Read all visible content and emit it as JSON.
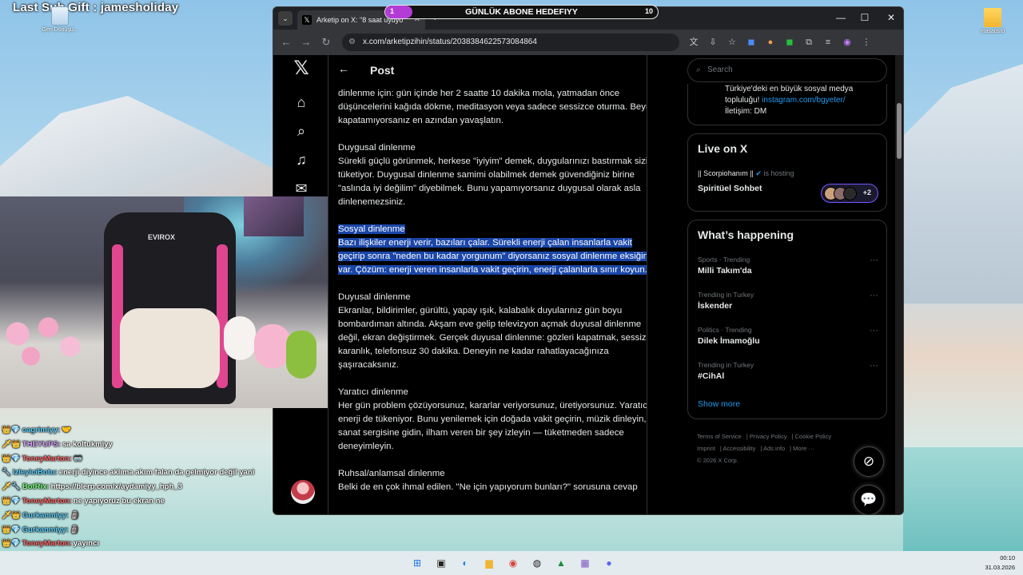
{
  "stream": {
    "last_sub_gift": "Last Sub Gift : jamesholiday",
    "goal": {
      "label": "GÜNLÜK ABONE HEDEFIYY",
      "current": "1",
      "target": "10",
      "progress": 0.1
    }
  },
  "desktop": {
    "recycle_label": "Geri Dönüşü...",
    "folder_label": "masaüstü"
  },
  "browser": {
    "tab_title": "Arketip on X: \"8 saat uyuyo",
    "url": "x.com/arketipzihin/status/2038384622573084864"
  },
  "x": {
    "post_header": "Post",
    "article": {
      "p0": "dinlenme için: gün içinde her 2 saatte 10 dakika mola, yatmadan önce düşüncelerini kağıda dökme, meditasyon veya sadece sessizce oturma. Beyni kapatamıyorsanız en azından yavaşlatın.",
      "emotional_heading": "Duygusal dinlenme",
      "emotional_body": "Sürekli güçlü görünmek, herkese \"iyiyim\" demek, duygularınızı bastırmak sizi tüketiyor. Duygusal dinlenme samimi olabilmek demek güvendiğiniz birine \"aslında iyi değilim\" diyebilmek. Bunu yapamıyorsanız duygusal olarak asla dinlenemezsiniz.",
      "social_heading": "Sosyal dinlenme",
      "social_body": "Bazı ilişkiler enerji verir, bazıları çalar. Sürekli enerji çalan insanlarla vakit geçirip sonra \"neden bu kadar yorgunum\" diyorsanız sosyal dinlenme eksiğiniz var. Çözüm: enerji veren insanlarla vakit geçirin, enerji çalanlarla sınır koyun.",
      "sensory_heading": "Duyusal dinlenme",
      "sensory_body": "Ekranlar, bildirimler, gürültü, yapay ışık, kalabalık duyularınız gün boyu bombardıman altında. Akşam eve gelip televizyon açmak duyusal dinlenme değil, ekran değiştirmek. Gerçek duyusal dinlenme: gözleri kapatmak, sessizlik, karanlık, telefonsuz 30 dakika. Deneyin ne kadar rahatlayacağınıza şaşıracaksınız.",
      "creative_heading": "Yaratıcı dinlenme",
      "creative_body": "Her gün problem çözüyorsunuz, kararlar veriyorsunuz, üretiyorsunuz. Yaratıcı enerji de tükeniyor. Bunu yenilemek için doğada vakit geçirin, müzik dinleyin, sanat sergisine gidin, ilham veren bir şey izleyin — tüketmeden sadece deneyimleyin.",
      "spiritual_heading": "Ruhsal/anlamsal dinlenme",
      "spiritual_body": "Belki de en çok ihmal edilen. \"Ne için yapıyorum bunları?\" sorusuna cevap"
    },
    "search_placeholder": "Search",
    "profile_bio": {
      "line1": "Türkiye'deki en büyük sosyal medya",
      "line2_prefix": "topluluğu! ",
      "line2_link": "instagram.com/bgyeter/",
      "line3": "İletişim: DM"
    },
    "live": {
      "heading": "Live on X",
      "host": "|| Scorpiohanım ||",
      "hosting_text": "is hosting",
      "space_title": "Spiritüel Sohbet",
      "listener_count": "+2"
    },
    "happening": {
      "heading": "What’s happening",
      "trends": [
        {
          "category": "Sports · Trending",
          "name": "Milli Takım'da"
        },
        {
          "category": "Trending in Turkey",
          "name": "İskender"
        },
        {
          "category": "Politics · Trending",
          "name": "Dilek İmamoğlu"
        },
        {
          "category": "Trending in Turkey",
          "name": "#CihAl"
        }
      ],
      "show_more": "Show more"
    },
    "footer": {
      "links": [
        "Terms of Service",
        "Privacy Policy",
        "Cookie Policy",
        "Imprint",
        "Accessibility",
        "Ads info",
        "More ···"
      ],
      "copyright": "© 2026 X Corp."
    }
  },
  "chat": [
    {
      "user": "cagrimiyy:",
      "msg": "🤝",
      "color": "#5fd3ff"
    },
    {
      "user": "THEYUPS:",
      "msg": "sa koltukmiyy",
      "color": "#d7a6ff"
    },
    {
      "user": "ToneyMarton:",
      "msg": "🥽",
      "color": "#ff6a6a"
    },
    {
      "user": "IzleyiciBotu:",
      "msg": "enerji diyince aklıma akım falan da gelmiyor değil yani",
      "color": "#5fd3ff"
    },
    {
      "user": "BotRix:",
      "msg": "https://blerp.com/x/aydamiyy_hph_3",
      "color": "#7bff7b"
    },
    {
      "user": "ToneyMarton:",
      "msg": "ne yapıyoruz bu ekran ne",
      "color": "#ff6a6a"
    },
    {
      "user": "Gurkanmiyy:",
      "msg": "🗿",
      "color": "#5fd3ff"
    },
    {
      "user": "Gurkanmiyy:",
      "msg": "🗿",
      "color": "#5fd3ff"
    },
    {
      "user": "ToneyMarton:",
      "msg": "yayıncı",
      "color": "#ff6a6a"
    }
  ],
  "taskbar": {
    "time": "00:10",
    "date": "31.03.2026"
  }
}
